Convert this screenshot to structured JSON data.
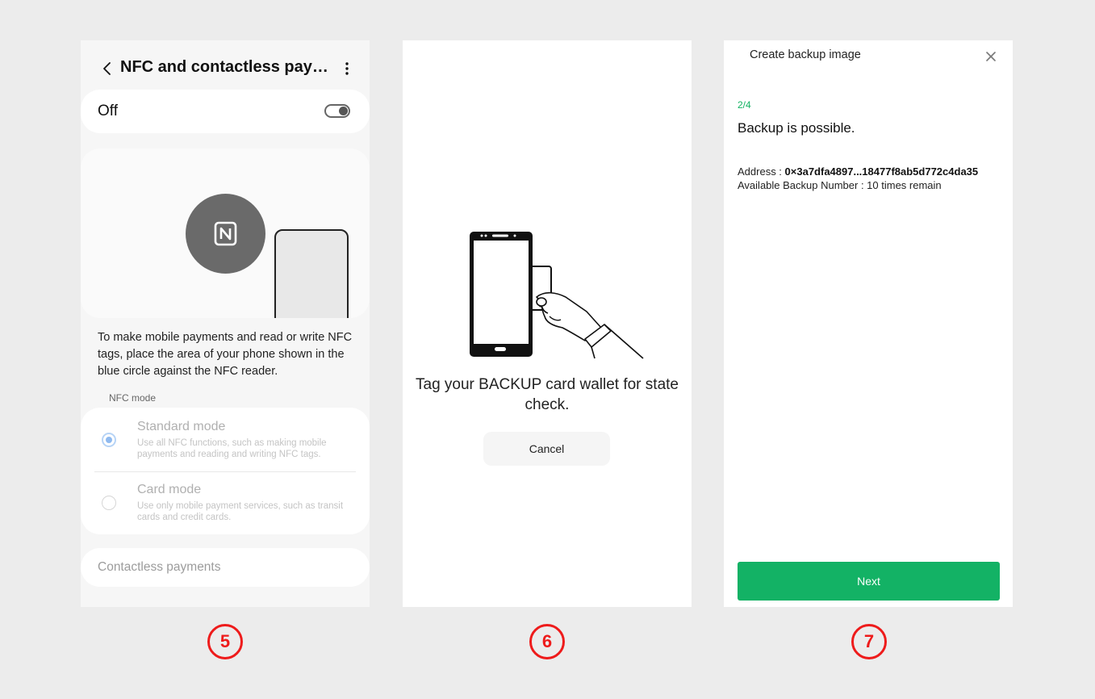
{
  "screen5": {
    "title": "NFC and contactless payme...",
    "back_icon": "chevron-left-icon",
    "more_icon": "more-vertical-icon",
    "nfc_toggle": {
      "label": "Off",
      "state": "off"
    },
    "illustration": {
      "icon": "nfc-icon",
      "circle_color": "#6a6a6a"
    },
    "description": "To make mobile payments and read or write NFC tags, place the area of your phone shown in the blue circle against the NFC reader.",
    "nfc_mode_label": "NFC mode",
    "modes": [
      {
        "title": "Standard mode",
        "description": "Use all NFC functions, such as making mobile payments and reading and writing NFC tags.",
        "selected": true
      },
      {
        "title": "Card mode",
        "description": "Use only mobile payment services, such as transit cards and credit cards.",
        "selected": false
      }
    ],
    "contactless_payments": "Contactless payments"
  },
  "screen6": {
    "illustration_icon": "phone-tap-card-icon",
    "message": "Tag your BACKUP card wallet for state check.",
    "cancel_label": "Cancel"
  },
  "screen7": {
    "title": "Create backup image",
    "close_icon": "close-icon",
    "step": "2/4",
    "heading": "Backup is possible.",
    "address_label": "Address : ",
    "address_value": "0×3a7dfa4897...18477f8ab5d772c4da35",
    "backup_number": "Available Backup Number : 10 times remain",
    "next_label": "Next",
    "accent_color": "#13b265"
  },
  "step_badges": [
    "5",
    "6",
    "7"
  ],
  "badge_color": "#ee1b1b"
}
